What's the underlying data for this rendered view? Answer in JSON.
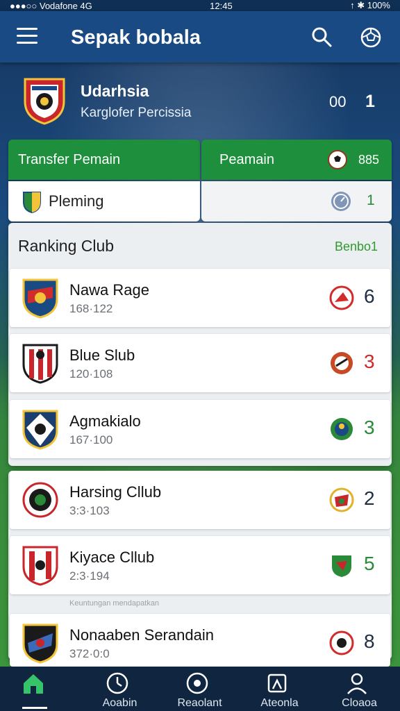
{
  "status_bar": {
    "left": "●●●○○ Vodafone  4G",
    "time": "12:45",
    "right": "↑ ✱ 100%"
  },
  "app_bar": {
    "title": "Sepak bobala"
  },
  "profile": {
    "name": "Udarhsia",
    "subtitle": "Karglofer Percissia",
    "stat_left": "00",
    "stat_right": "1"
  },
  "tabs": {
    "transfer": "Transfer Pemain",
    "peamain": "Peamain",
    "peamain_count": "885"
  },
  "pleming": {
    "label": "Pleming",
    "count": "1"
  },
  "ranking": {
    "title": "Ranking Club",
    "link": "Benbo1",
    "rows": [
      {
        "name": "Nawa Rage",
        "score": "168·122",
        "rank": "6",
        "rank_color": "#1f2d44",
        "badge_color": "#d12b2b"
      },
      {
        "name": "Blue Slub",
        "score": "120·108",
        "rank": "3",
        "rank_color": "#cc2a2a",
        "badge_color": "#c84a24"
      },
      {
        "name": "Agmakialo",
        "score": "167·100",
        "rank": "3",
        "rank_color": "#2a8a3a",
        "badge_color": "#2a8a3a"
      },
      {
        "name": "Harsing Cllub",
        "score": "3:3·103",
        "rank": "2",
        "rank_color": "#1f2d44",
        "badge_color": "#e0b22a"
      },
      {
        "name": "Kiyace Cllub",
        "score": "2:3·194",
        "rank": "5",
        "rank_color": "#2a8a3a",
        "badge_color": "#2a8a3a"
      },
      {
        "name": "Nonaaben Serandain",
        "score": "372·0:0",
        "rank": "8",
        "rank_color": "#1f2d44",
        "badge_color": "#d12b2b"
      }
    ]
  },
  "footnote": "Keuntungan mendapatkan",
  "bottom_nav": [
    {
      "label": "",
      "icon": "home-icon"
    },
    {
      "label": "Aoabin",
      "icon": "clock-icon"
    },
    {
      "label": "Reaolant",
      "icon": "record-icon"
    },
    {
      "label": "Ateonla",
      "icon": "transfer-icon"
    },
    {
      "label": "Cloaoa",
      "icon": "profile-icon"
    }
  ]
}
